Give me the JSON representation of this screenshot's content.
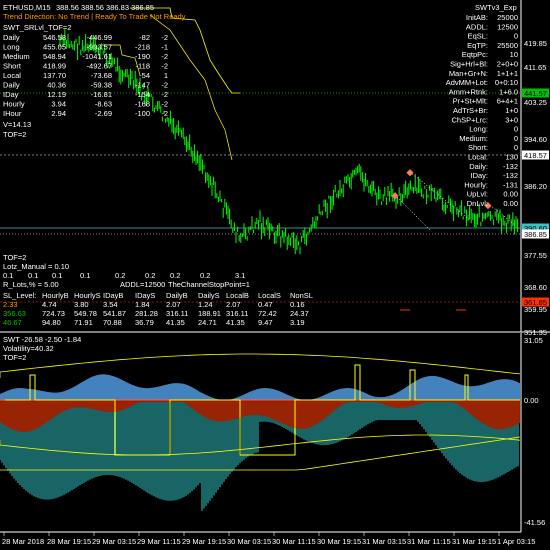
{
  "window": {
    "title": "ETHUSD,M15",
    "ohlc": "388.56 388.56 386.83 386.85",
    "indicator_name": "SWTv3_Exp",
    "status": "Trend Direction:  No Trend  |  Ready To Trade   Not Ready"
  },
  "colors": {
    "bg": "#000000",
    "candle": "#00ff00",
    "yellow": "#ffff00",
    "white": "#ffffff",
    "orange_text": "#ff9900",
    "green_text": "#00c000",
    "red_band": "#a02000",
    "blue_band": "#4a90d0",
    "teal_hist": "#2aa6a6",
    "marker": "#ff7f50"
  },
  "left_panel": {
    "header": "SWT_SRLvl_TOF=2",
    "rows": [
      {
        "label": "Daily",
        "v1": "546.58",
        "v2": "-446.99",
        "v3": "-82",
        "v4": "-2"
      },
      {
        "label": "Long",
        "v1": "455.05",
        "v2": "-993.57",
        "v3": "-218",
        "v4": "-1"
      },
      {
        "label": "Medium",
        "v1": "548.94",
        "v2": "-1041.61",
        "v3": "-190",
        "v4": "-2"
      },
      {
        "label": "Short",
        "v1": "418.99",
        "v2": "-492.67",
        "v3": "-118",
        "v4": "-2"
      },
      {
        "label": "Local",
        "v1": "137.70",
        "v2": "-73.68",
        "v3": "-54",
        "v4": "1"
      },
      {
        "label": "Daily",
        "v1": "40.36",
        "v2": "-59.38",
        "v3": "-147",
        "v4": "-2"
      },
      {
        "label": "IDay",
        "v1": "12.19",
        "v2": "-16.81",
        "v3": "-154",
        "v4": "-2"
      },
      {
        "label": "Hourly",
        "v1": "3.94",
        "v2": "-8.63",
        "v3": "-168",
        "v4": "-2"
      },
      {
        "label": "IHour",
        "v1": "2.94",
        "v2": "-2.69",
        "v3": "-100",
        "v4": "-2"
      }
    ],
    "vline": "V=14.13",
    "tof": "TOF=2"
  },
  "right_panel": {
    "rows": [
      {
        "label": "InitAB:",
        "value": "25000"
      },
      {
        "label": "ADDL:",
        "value": "12500"
      },
      {
        "label": "EqSL:",
        "value": "0"
      },
      {
        "label": "EqTP:",
        "value": "25500"
      },
      {
        "label": "EqtpPc:",
        "value": "10"
      },
      {
        "label": "Sig+Hrl+Bl:",
        "value": "2+0+0"
      },
      {
        "label": "Man+Gr+N:",
        "value": "1+1+1"
      },
      {
        "label": "AdvMM+Lot:",
        "value": "0+0:10"
      },
      {
        "label": "Amm+Rtnk:",
        "value": "1+6.0"
      },
      {
        "label": "Pr+St+Mlt:",
        "value": "6+4+1"
      },
      {
        "label": "AdTrS+Br:",
        "value": "1+0"
      },
      {
        "label": "ChSP+Lrc:",
        "value": "3+0"
      },
      {
        "label": "Long:",
        "value": "0"
      },
      {
        "label": "Medium:",
        "value": "0"
      },
      {
        "label": "Short:",
        "value": "0"
      },
      {
        "label": "Local:",
        "value": "130"
      },
      {
        "label": "Daily:",
        "value": "-132"
      },
      {
        "label": "IDay:",
        "value": "-132"
      },
      {
        "label": "Hourly:",
        "value": "-131"
      },
      {
        "label": "UpLvl:",
        "value": "0.00"
      },
      {
        "label": "DnLvl:",
        "value": "0.00"
      }
    ]
  },
  "bottom_panel": {
    "tof": "TOF=2",
    "lotz": "Lotz_Manual = 0.10",
    "rlots": "R_Lots,% = 5.00",
    "addl": "ADDL=12500",
    "channel": "TheChannelStopPoint=1",
    "col_headers_row": [
      "0.1",
      "0.1",
      "0.1",
      "0.1",
      "0.2",
      "0.2",
      "0.2",
      "0.2",
      "3.1"
    ],
    "sl_headers": [
      "SL_Level:",
      "HourlyB",
      "HourlyS",
      "IDayB",
      "IDayS",
      "DailyB",
      "DailyS",
      "LocalB",
      "LocalS",
      "NonSL"
    ],
    "sl_rows": [
      [
        "2.33",
        "4.74",
        "3.80",
        "3.54",
        "1.84",
        "2.07",
        "1.24",
        "2.07",
        "0.47",
        "0.16"
      ],
      [
        "356.63",
        "724.73",
        "549.78",
        "541.87",
        "281.28",
        "316.11",
        "188.91",
        "316.11",
        "72.42",
        "24.37"
      ],
      [
        "46.67",
        "94.80",
        "71.91",
        "70.88",
        "36.79",
        "41.35",
        "24.71",
        "41.35",
        "9.47",
        "3.19"
      ]
    ]
  },
  "price_axis": {
    "ticks": [
      "419.85",
      "411.65",
      "403.25",
      "394.60",
      "386.20",
      "377.55",
      "368.60",
      "359.95",
      "351.35"
    ],
    "labels": [
      {
        "text": "441.57",
        "bg": "#00c000",
        "fg": "#000000"
      },
      {
        "text": "418.57",
        "bg": "#ffffff",
        "fg": "#000000"
      },
      {
        "text": "390.60",
        "bg": "#40c0c0",
        "fg": "#000000"
      },
      {
        "text": "386.85",
        "bg": "#ffffff",
        "fg": "#000000"
      },
      {
        "text": "361.85",
        "bg": "#ff3000",
        "fg": "#000000"
      }
    ]
  },
  "sub_window": {
    "title": "SWT -26.58 -2.50 -1.84",
    "volatility": "Volatility=40.32",
    "tof": "TOF=2",
    "ticks": [
      "31.05",
      "0.00",
      "-41.56"
    ]
  },
  "time_axis": [
    "28 Mar 2018",
    "28 Mar 19:15",
    "29 Mar 03:15",
    "29 Mar 11:15",
    "29 Mar 19:15",
    "30 Mar 03:15",
    "30 Mar 11:15",
    "30 Mar 19:15",
    "31 Mar 03:15",
    "31 Mar 11:15",
    "31 Mar 19:15",
    "1 Apr 03:15"
  ]
}
